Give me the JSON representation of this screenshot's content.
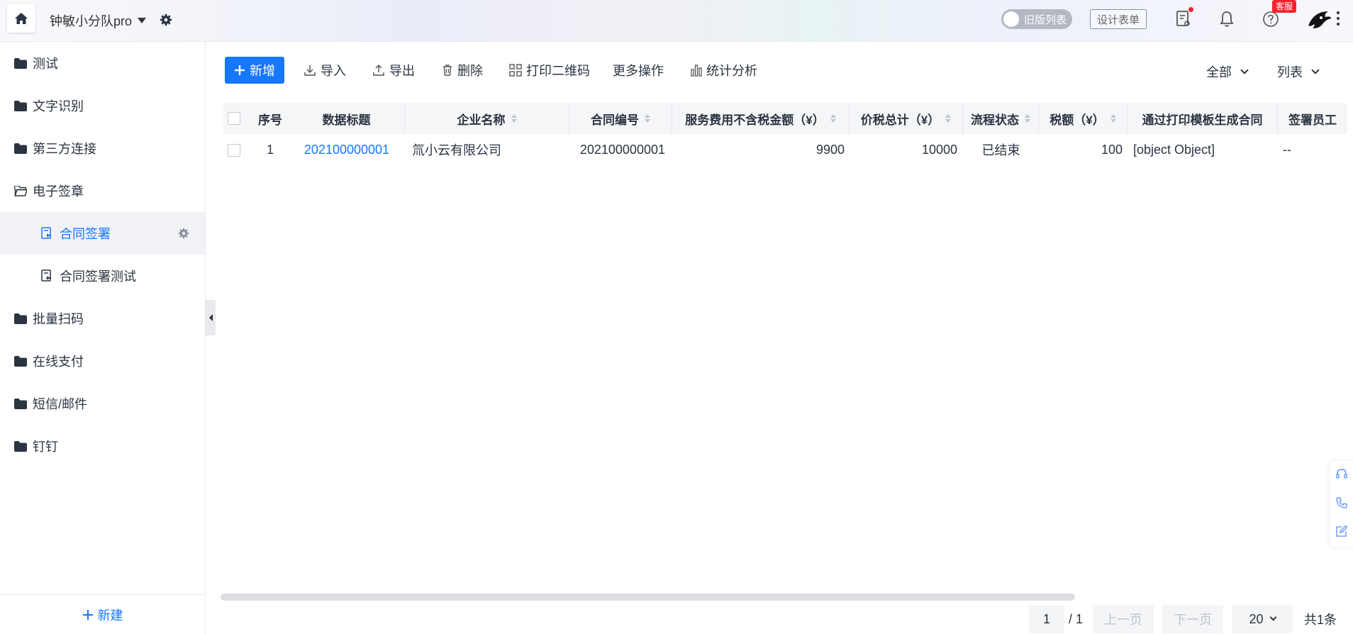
{
  "header": {
    "app_name": "钟敏小分队pro",
    "old_list_toggle": "旧版列表",
    "design_form": "设计表单",
    "kefu_badge": "客服"
  },
  "sidebar": {
    "items": [
      {
        "label": "测试",
        "type": "folder"
      },
      {
        "label": "文字识别",
        "type": "folder"
      },
      {
        "label": "第三方连接",
        "type": "folder"
      },
      {
        "label": "电子签章",
        "type": "folder-open"
      },
      {
        "label": "合同签署",
        "type": "form",
        "active": true
      },
      {
        "label": "合同签署测试",
        "type": "form"
      },
      {
        "label": "批量扫码",
        "type": "folder"
      },
      {
        "label": "在线支付",
        "type": "folder"
      },
      {
        "label": "短信/邮件",
        "type": "folder"
      },
      {
        "label": "钉钉",
        "type": "folder"
      }
    ],
    "new_label": "新建"
  },
  "toolbar": {
    "new_label": "新增",
    "import_label": "导入",
    "export_label": "导出",
    "delete_label": "删除",
    "print_qr_label": "打印二维码",
    "more_label": "更多操作",
    "stats_label": "统计分析",
    "filter_label": "全部",
    "view_label": "列表"
  },
  "table": {
    "columns": [
      "序号",
      "数据标题",
      "企业名称",
      "合同编号",
      "服务费用不含税金额（¥）",
      "价税总计（¥）",
      "流程状态",
      "税额（¥）",
      "通过打印模板生成合同",
      "签署员工"
    ],
    "rows": [
      [
        "1",
        "202100000001",
        "氚小云有限公司",
        "202100000001",
        "9900",
        "10000",
        "已结束",
        "100",
        "[object Object]",
        "--"
      ]
    ]
  },
  "pager": {
    "current_page": "1",
    "total_pages": "/ 1",
    "prev_label": "上一页",
    "next_label": "下一页",
    "page_size": "20",
    "total_label": "共1条"
  },
  "colors": {
    "accent": "#1677ff",
    "sidebar_text": "#2b3441",
    "badge_red": "#f5222d"
  }
}
